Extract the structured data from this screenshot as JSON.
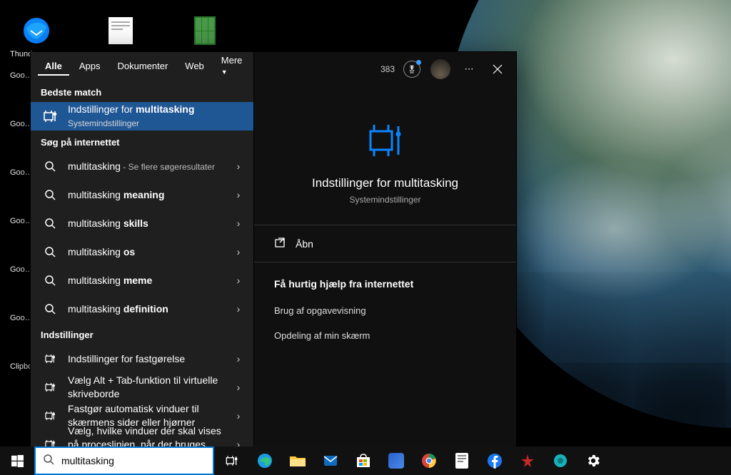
{
  "desktop_icons": {
    "thunderbird": "Thunderbird",
    "google_generic": "Goo…",
    "clipboard": "Clipbo…"
  },
  "search": {
    "header_tabs": {
      "all": "Alle",
      "apps": "Apps",
      "documents": "Dokumenter",
      "web": "Web",
      "more": "Mere"
    },
    "rewards_count": "383",
    "sections": {
      "best_match": "Bedste match",
      "search_web": "Søg på internettet",
      "settings": "Indstillinger"
    },
    "best_result": {
      "title_prefix": "Indstillinger for ",
      "title_strong": "multitasking",
      "subtitle": "Systemindstillinger"
    },
    "web_results": {
      "r0": {
        "pre": "multitasking",
        "post": "",
        "hint": " - Se flere søgeresultater"
      },
      "r1": {
        "pre": "multitasking ",
        "post": "meaning"
      },
      "r2": {
        "pre": "multitasking ",
        "post": "skills"
      },
      "r3": {
        "pre": "multitasking ",
        "post": "os"
      },
      "r4": {
        "pre": "multitasking ",
        "post": "meme"
      },
      "r5": {
        "pre": "multitasking ",
        "post": "definition"
      }
    },
    "settings_results": {
      "s0": "Indstillinger for fastgørelse",
      "s1": "Vælg Alt + Tab-funktion til virtuelle skriveborde",
      "s2": "Fastgør automatisk vinduer til skærmens sider eller hjørner",
      "s3": "Vælg, hvilke vinduer der skal vises på proceslinjen, når der bruges virtuelle"
    },
    "detail": {
      "title": "Indstillinger for multitasking",
      "subtitle": "Systemindstillinger",
      "open": "Åbn",
      "help_header": "Få hurtig hjælp fra internettet",
      "help1": "Brug af opgavevisning",
      "help2": "Opdeling af min skærm"
    },
    "input_value": "multitasking"
  }
}
